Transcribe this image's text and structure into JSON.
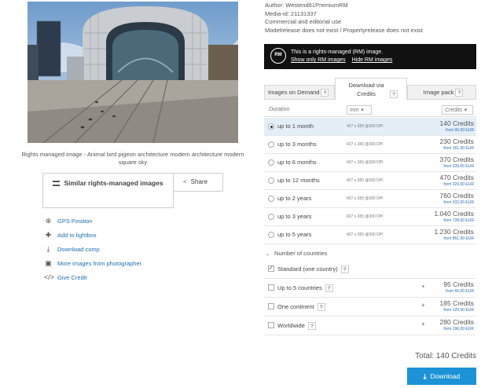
{
  "image": {
    "caption": "Rights managed image - Animal bird pigeon architecture modern architecture modern square sky"
  },
  "actions": {
    "similar_label": "Similar rights-managed images",
    "share_label": "Share"
  },
  "links": [
    {
      "icon": "crosshair-icon",
      "label": "GPS Position"
    },
    {
      "icon": "plus-icon",
      "label": "Add to lightbox"
    },
    {
      "icon": "download-icon",
      "label": "Download comp"
    },
    {
      "icon": "gallery-icon",
      "label": "More images from photographer"
    },
    {
      "icon": "code-icon",
      "label": "Give Credit"
    }
  ],
  "meta": {
    "author": "Author: Westend61PremiumRM",
    "media_id": "Media-id: 21131337",
    "use": "Commercial and editorial use",
    "release": "Modelrelease does not exist / Propertyrelease does not exist"
  },
  "rm_banner": {
    "badge": "RM",
    "text": "This is a rights-managed (RM) image.",
    "link1": "Show only RM images",
    "link2": "Hide RM images"
  },
  "tabs": [
    {
      "label": "Images on Demand",
      "q": "?"
    },
    {
      "label": "Download via Credits",
      "q": "?"
    },
    {
      "label": "Image pack",
      "q": "?"
    }
  ],
  "columns": {
    "duration": "Duration",
    "unit": "mm",
    "credits": "Credits"
  },
  "durations": [
    {
      "label": "up to 1 month",
      "size": "427 x 283 @300 DPI",
      "credits": "140 Credits",
      "eur": "from 90,00 EUR",
      "selected": true
    },
    {
      "label": "up to 3 months",
      "size": "427 x 283 @300 DPI",
      "credits": "230 Credits",
      "eur": "from 161,00 EUR",
      "selected": false
    },
    {
      "label": "up to 6 months",
      "size": "427 x 283 @300 DPI",
      "credits": "370 Credits",
      "eur": "from 239,00 EUR",
      "selected": false
    },
    {
      "label": "up to 12 months",
      "size": "427 x 283 @300 DPI",
      "credits": "470 Credits",
      "eur": "from 329,00 EUR",
      "selected": false
    },
    {
      "label": "up to 2 years",
      "size": "427 x 283 @300 DPI",
      "credits": "760 Credits",
      "eur": "from 532,00 EUR",
      "selected": false
    },
    {
      "label": "up to 3 years",
      "size": "427 x 283 @300 DPI",
      "credits": "1.040 Credits",
      "eur": "from 728,00 EUR",
      "selected": false
    },
    {
      "label": "up to 5 years",
      "size": "427 x 283 @300 DPI",
      "credits": "1.230 Credits",
      "eur": "from 861,00 EUR",
      "selected": false
    }
  ],
  "countries": {
    "heading": "Number of countries",
    "items": [
      {
        "label": "Standard (one country)",
        "plus": "",
        "credits": "",
        "eur": "",
        "checked": true
      },
      {
        "label": "Up to 5 countries",
        "plus": "+",
        "credits": "95 Credits",
        "eur": "from 66,50 EUR",
        "checked": false
      },
      {
        "label": "One continent",
        "plus": "+",
        "credits": "185 Credits",
        "eur": "from 129,50 EUR",
        "checked": false
      },
      {
        "label": "Worldwide",
        "plus": "+",
        "credits": "280 Credits",
        "eur": "from 196,00 EUR",
        "checked": false
      }
    ]
  },
  "total": "Total: 140 Credits",
  "download_label": "Download",
  "colors": {
    "accent": "#1c93d6",
    "selected_row": "#e4eef7",
    "banner": "#111111"
  }
}
